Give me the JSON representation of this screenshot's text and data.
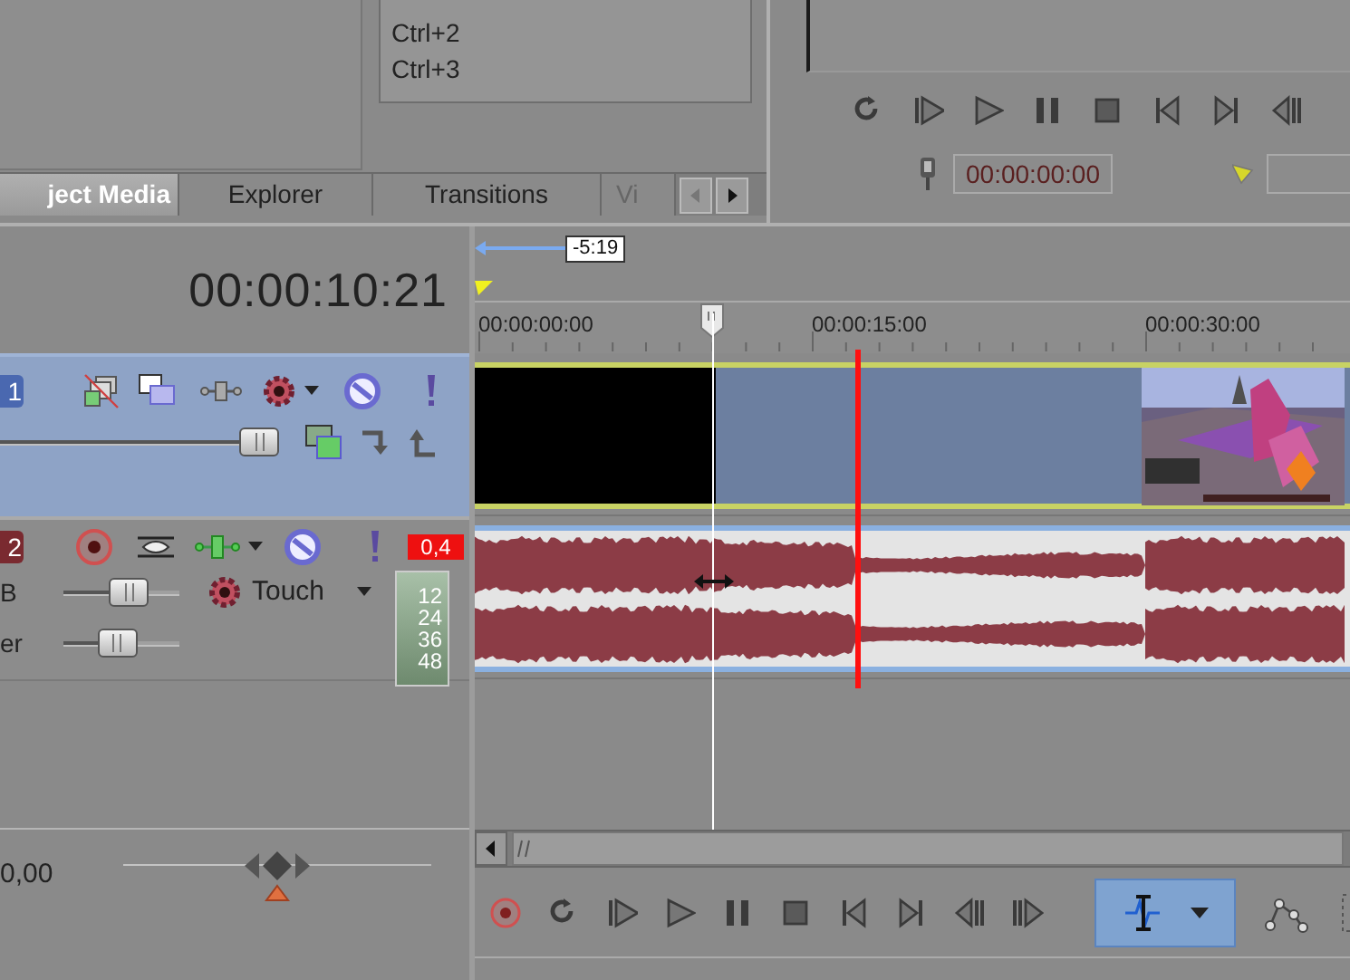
{
  "media_list": {
    "lines": [
      "Ctrl+2",
      "Ctrl+3"
    ]
  },
  "docked_tabs": [
    {
      "label": "ject Media",
      "selected": true
    },
    {
      "label": "Explorer",
      "selected": false
    },
    {
      "label": "Transitions",
      "selected": false
    },
    {
      "label": "Vi",
      "selected": false
    }
  ],
  "preview": {
    "transport": [
      {
        "kind": "loop"
      },
      {
        "kind": "play_start"
      },
      {
        "kind": "play"
      },
      {
        "kind": "pause"
      },
      {
        "kind": "stop"
      },
      {
        "kind": "prev"
      },
      {
        "kind": "next"
      },
      {
        "kind": "prev_frame"
      }
    ],
    "timecode": "00:00:00:00"
  },
  "timeline": {
    "cursor_time": "00:00:10:21",
    "loop_length": "-5:19",
    "ruler_labels": [
      "00:00:00:00",
      "00:00:15:00",
      "00:00:30:00"
    ]
  },
  "tracks": [
    {
      "kind": "video",
      "number": "1",
      "level": 1
    },
    {
      "kind": "audio",
      "number": "2",
      "peak": "0,4",
      "volume_label": "B",
      "level": 0.6,
      "automation_mode": "Touch",
      "pan": {
        "label": "er",
        "level": 0.45
      },
      "meter_scale": [
        "12",
        "24",
        "36",
        "48"
      ]
    }
  ],
  "rate": {
    "value": "0,00",
    "level": 0.5
  },
  "bottom_transport": [
    {
      "kind": "record"
    },
    {
      "kind": "loop"
    },
    {
      "kind": "play_start"
    },
    {
      "kind": "play"
    },
    {
      "kind": "pause"
    },
    {
      "kind": "stop"
    },
    {
      "kind": "prev"
    },
    {
      "kind": "next"
    },
    {
      "kind": "prev_frame"
    },
    {
      "kind": "next_frame"
    }
  ],
  "tools": [
    {
      "kind": "edit",
      "selected": true
    },
    {
      "kind": "envelope",
      "selected": false
    },
    {
      "kind": "selection",
      "selected": false
    }
  ]
}
